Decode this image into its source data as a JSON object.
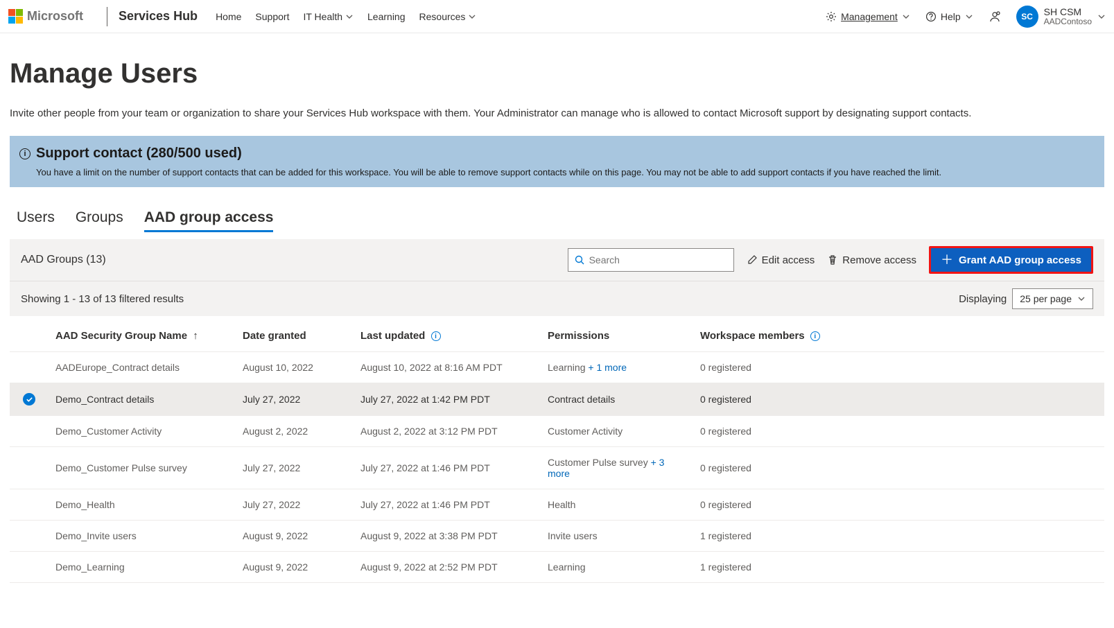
{
  "header": {
    "microsoft_word": "Microsoft",
    "app_name": "Services Hub",
    "nav": {
      "home": "Home",
      "support": "Support",
      "it_health": "IT Health",
      "learning": "Learning",
      "resources": "Resources"
    },
    "right": {
      "management": "Management",
      "help": "Help",
      "user_initials": "SC",
      "user_name": "SH CSM",
      "user_org": "AADContoso"
    }
  },
  "page": {
    "title": "Manage Users",
    "description": "Invite other people from your team or organization to share your Services Hub workspace with them. Your Administrator can manage who is allowed to contact Microsoft support by designating support contacts."
  },
  "banner": {
    "title": "Support contact (280/500 used)",
    "body": "You have a limit on the number of support contacts that can be added for this workspace. You will be able to remove support contacts while on this page. You may not be able to add support contacts if you have reached the limit."
  },
  "tabs": {
    "users": "Users",
    "groups": "Groups",
    "aad": "AAD group access"
  },
  "toolbar": {
    "group_title": "AAD Groups (13)",
    "search_placeholder": "Search",
    "edit_access": "Edit access",
    "remove_access": "Remove access",
    "grant_btn": "Grant AAD group access"
  },
  "results": {
    "showing": "Showing 1 - 13 of 13 filtered results",
    "displaying": "Displaying",
    "per_page": "25 per page"
  },
  "table": {
    "headers": {
      "name": "AAD Security Group Name",
      "date": "Date granted",
      "updated": "Last updated",
      "permissions": "Permissions",
      "members": "Workspace members"
    },
    "rows": [
      {
        "selected": false,
        "name": "AADEurope_Contract details",
        "date": "August 10, 2022",
        "updated": "August 10, 2022 at 8:16 AM PDT",
        "perm": "Learning",
        "more": "+ 1 more",
        "members": "0 registered"
      },
      {
        "selected": true,
        "name": "Demo_Contract details",
        "date": "July 27, 2022",
        "updated": "July 27, 2022 at 1:42 PM PDT",
        "perm": "Contract details",
        "more": "",
        "members": "0 registered"
      },
      {
        "selected": false,
        "name": "Demo_Customer Activity",
        "date": "August 2, 2022",
        "updated": "August 2, 2022 at 3:12 PM PDT",
        "perm": "Customer Activity",
        "more": "",
        "members": "0 registered"
      },
      {
        "selected": false,
        "name": "Demo_Customer Pulse survey",
        "date": "July 27, 2022",
        "updated": "July 27, 2022 at 1:46 PM PDT",
        "perm": "Customer Pulse survey",
        "more": "+ 3 more",
        "members": "0 registered"
      },
      {
        "selected": false,
        "name": "Demo_Health",
        "date": "July 27, 2022",
        "updated": "July 27, 2022 at 1:46 PM PDT",
        "perm": "Health",
        "more": "",
        "members": "0 registered"
      },
      {
        "selected": false,
        "name": "Demo_Invite users",
        "date": "August 9, 2022",
        "updated": "August 9, 2022 at 3:38 PM PDT",
        "perm": "Invite users",
        "more": "",
        "members": "1 registered"
      },
      {
        "selected": false,
        "name": "Demo_Learning",
        "date": "August 9, 2022",
        "updated": "August 9, 2022 at 2:52 PM PDT",
        "perm": "Learning",
        "more": "",
        "members": "1 registered"
      }
    ]
  }
}
